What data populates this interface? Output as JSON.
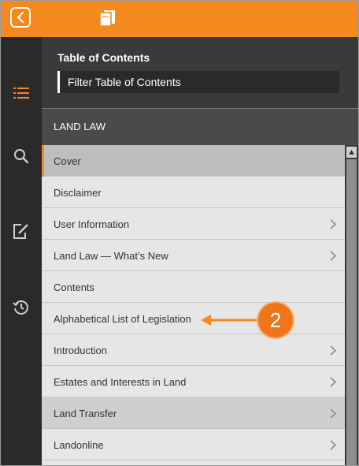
{
  "toolbar": {
    "back_icon": "chevron-left-icon",
    "books_icon": "books-icon"
  },
  "left_rail": {
    "icons": [
      "list-icon",
      "search-icon",
      "edit-note-icon",
      "history-icon"
    ]
  },
  "toc": {
    "title": "Table of Contents",
    "filter_placeholder": "Filter Table of Contents",
    "section": "LAND LAW",
    "items": [
      {
        "label": "Cover",
        "has_children": false
      },
      {
        "label": "Disclaimer",
        "has_children": false
      },
      {
        "label": "User Information",
        "has_children": true
      },
      {
        "label": "Land Law — What’s New",
        "has_children": true
      },
      {
        "label": "Contents",
        "has_children": false
      },
      {
        "label": "Alphabetical List of Legislation",
        "has_children": false
      },
      {
        "label": "Introduction",
        "has_children": true
      },
      {
        "label": "Estates and Interests in Land",
        "has_children": true
      },
      {
        "label": "Land Transfer",
        "has_children": true
      },
      {
        "label": "Landonline",
        "has_children": true
      }
    ]
  },
  "annotation": {
    "number": "2"
  },
  "colors": {
    "accent": "#f48a1e",
    "rail": "#2a2a2a",
    "panel": "#3c3c3c",
    "list_bg": "#e6e6e6"
  }
}
